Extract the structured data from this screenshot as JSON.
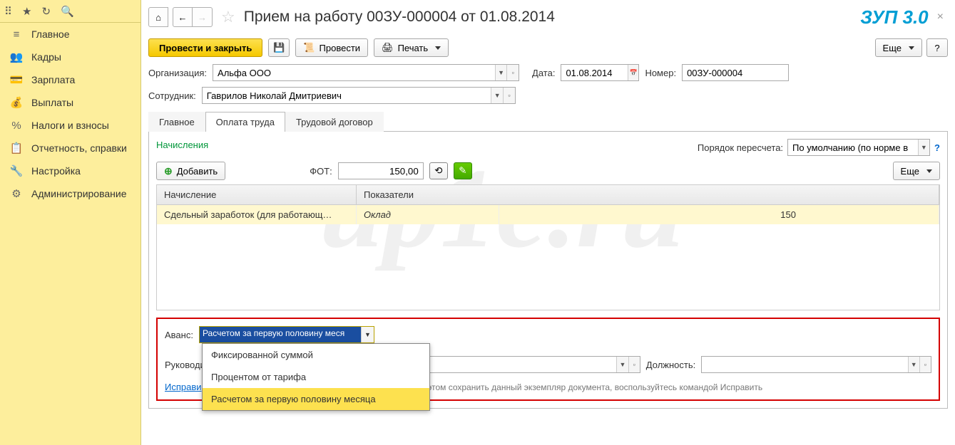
{
  "sidebar": {
    "items": [
      {
        "icon": "≡",
        "label": "Главное"
      },
      {
        "icon": "👥",
        "label": "Кадры"
      },
      {
        "icon": "💳",
        "label": "Зарплата"
      },
      {
        "icon": "💰",
        "label": "Выплаты"
      },
      {
        "icon": "%",
        "label": "Налоги и взносы"
      },
      {
        "icon": "📋",
        "label": "Отчетность, справки"
      },
      {
        "icon": "🔧",
        "label": "Настройка"
      },
      {
        "icon": "⚙",
        "label": "Администрирование"
      }
    ]
  },
  "title": "Прием на работу 00ЗУ-000004 от 01.08.2014",
  "version": "ЗУП 3.0",
  "toolbar": {
    "post_close": "Провести и закрыть",
    "post": "Провести",
    "print": "Печать",
    "more": "Еще"
  },
  "fields": {
    "org_label": "Организация:",
    "org_value": "Альфа ООО",
    "date_label": "Дата:",
    "date_value": "01.08.2014",
    "num_label": "Номер:",
    "num_value": "00ЗУ-000004",
    "emp_label": "Сотрудник:",
    "emp_value": "Гаврилов Николай Дмитриевич"
  },
  "tabs": [
    "Главное",
    "Оплата труда",
    "Трудовой договор"
  ],
  "accruals": {
    "title": "Начисления",
    "order_label": "Порядок пересчета:",
    "order_value": "По умолчанию (по норме в",
    "add": "Добавить",
    "fot_label": "ФОТ:",
    "fot_value": "150,00",
    "more": "Еще",
    "col1": "Начисление",
    "col2": "Показатели",
    "row_name": "Сдельный заработок (для работающ…",
    "row_ind": "Оклад",
    "row_val": "150"
  },
  "avans": {
    "label": "Аванс:",
    "value": "Расчетом за первую половину меся",
    "options": [
      "Фиксированной суммой",
      "Процентом от тарифа",
      "Расчетом за первую половину месяца"
    ]
  },
  "ruk": {
    "label": "Руководи",
    "pos_label": "Должность:"
  },
  "ispravit": {
    "link": "Исправи",
    "text": "ри этом сохранить данный экземпляр документа, воспользуйтесь командой Исправить"
  }
}
